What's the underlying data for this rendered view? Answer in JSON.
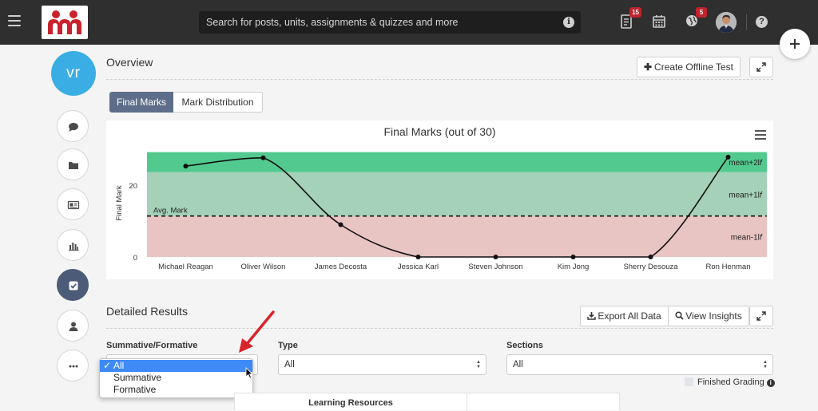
{
  "topbar": {
    "search_placeholder": "Search for posts, units, assignments & quizzes and more",
    "notifications_badge": "15",
    "alerts_badge": "5"
  },
  "sidebar": {
    "user_initials": "vr",
    "items": [
      {
        "icon": "chat-icon"
      },
      {
        "icon": "folder-icon"
      },
      {
        "icon": "newspaper-icon"
      },
      {
        "icon": "bar-chart-icon"
      },
      {
        "icon": "checkbox-icon",
        "active": true
      },
      {
        "icon": "user-icon"
      },
      {
        "icon": "more-icon"
      }
    ]
  },
  "overview": {
    "title": "Overview",
    "create_offline_test_label": "Create Offline Test",
    "tabs": [
      {
        "label": "Final Marks",
        "active": true
      },
      {
        "label": "Mark Distribution",
        "active": false
      }
    ]
  },
  "chart_data": {
    "type": "line",
    "title": "Final Marks (out of 30)",
    "ylabel": "Final Mark",
    "xlabel": "",
    "yticks": [
      "0",
      "20"
    ],
    "categories": [
      "Michael Reagan",
      "Oliver Wilson",
      "James Decosta",
      "Jessica Karl",
      "Steven Johnson",
      "Kim Jong",
      "Sherry Desouza",
      "Ron Henman"
    ],
    "values": [
      25.3,
      27.6,
      9.0,
      0,
      0,
      0,
      0,
      27.8
    ],
    "ylim": [
      0,
      30
    ],
    "bands": [
      {
        "label": "mean+2l𝑓",
        "from": 23.6,
        "to": 29.2,
        "color": "#52c98e"
      },
      {
        "label": "mean+1l𝑓",
        "from": 11.4,
        "to": 23.6,
        "color": "#a4d1b8"
      },
      {
        "label": "mean-1l𝑓",
        "from": 0,
        "to": 11.4,
        "color": "#e8c4c2"
      }
    ],
    "avg_mark": {
      "label": "Avg. Mark",
      "value": 11.4
    }
  },
  "detailed": {
    "title": "Detailed Results",
    "export_label": "Export All Data",
    "insights_label": "View Insights",
    "filters": {
      "summative_label": "Summative/Formative",
      "summative_options": [
        "All",
        "Summative",
        "Formative"
      ],
      "summative_selected": "All",
      "type_label": "Type",
      "type_value": "All",
      "sections_label": "Sections",
      "sections_value": "All"
    },
    "finished_grading_label": "Finished Grading",
    "table_header": "Learning Resources"
  },
  "colors": {
    "topbar": "#2f2f2f",
    "accent": "#3aaee4",
    "tab_active": "#5e6e8a",
    "badge": "#c0232c",
    "selection": "#3e8af7",
    "annotation_arrow": "#d9232a"
  }
}
